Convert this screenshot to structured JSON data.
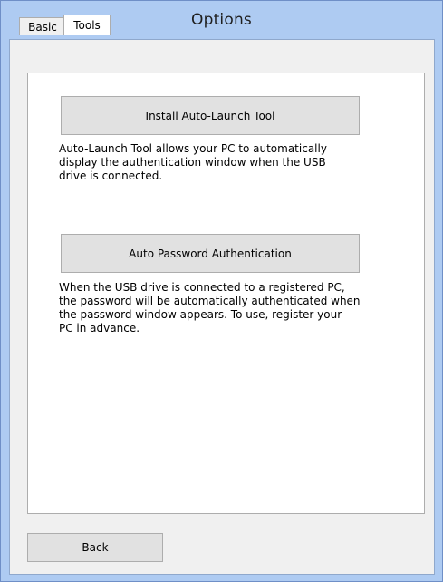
{
  "window": {
    "title": "Options"
  },
  "tabs": [
    {
      "label": "Basic",
      "selected": false
    },
    {
      "label": "Tools",
      "selected": true
    }
  ],
  "tools": {
    "install_button_label": "Install Auto-Launch Tool",
    "install_description": "Auto-Launch Tool allows your PC to automatically\ndisplay the  authentication window when the USB\ndrive is connected.",
    "auto_password_button_label": "Auto Password Authentication",
    "auto_password_description": "When the USB drive is connected to a registered PC,\nthe password will be automatically authenticated when\nthe password window appears. To use, register your\nPC in advance."
  },
  "footer": {
    "back_label": "Back"
  }
}
